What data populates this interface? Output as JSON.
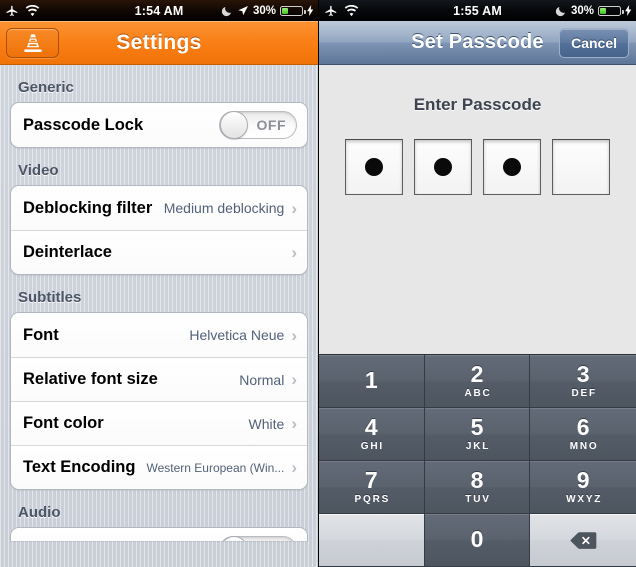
{
  "left_pane": {
    "status_bar": {
      "icons_left": [
        "airplane-icon",
        "wifi-icon"
      ],
      "time": "1:54 AM",
      "icons_right": [
        "moon-icon",
        "location-arrow-icon"
      ],
      "battery_percent": "30%",
      "battery_level": 30,
      "charging": true
    },
    "nav": {
      "app_icon": "vlc-cone-icon",
      "title": "Settings"
    },
    "sections": [
      {
        "header": "Generic",
        "rows": [
          {
            "label": "Passcode Lock",
            "type": "switch",
            "state": "OFF"
          }
        ]
      },
      {
        "header": "Video",
        "rows": [
          {
            "label": "Deblocking filter",
            "value": "Medium deblocking",
            "type": "disclosure"
          },
          {
            "label": "Deinterlace",
            "value": "",
            "type": "disclosure"
          }
        ]
      },
      {
        "header": "Subtitles",
        "rows": [
          {
            "label": "Font",
            "value": "Helvetica Neue",
            "type": "disclosure"
          },
          {
            "label": "Relative font size",
            "value": "Normal",
            "type": "disclosure"
          },
          {
            "label": "Font color",
            "value": "White",
            "type": "disclosure"
          },
          {
            "label": "Text Encoding",
            "value": "Western European (Win...",
            "type": "disclosure"
          }
        ]
      },
      {
        "header": "Audio",
        "rows": [
          {
            "label": "",
            "value": "",
            "type": "clipped"
          }
        ]
      }
    ]
  },
  "right_pane": {
    "status_bar": {
      "icons_left": [
        "airplane-icon",
        "wifi-icon"
      ],
      "time": "1:55 AM",
      "icons_right": [
        "moon-icon"
      ],
      "battery_percent": "30%",
      "battery_level": 30,
      "charging": true
    },
    "nav": {
      "title": "Set Passcode",
      "cancel_label": "Cancel"
    },
    "passcode": {
      "prompt": "Enter Passcode",
      "total_boxes": 4,
      "filled_boxes": 3
    },
    "keypad": [
      {
        "num": "1",
        "letters": ""
      },
      {
        "num": "2",
        "letters": "ABC"
      },
      {
        "num": "3",
        "letters": "DEF"
      },
      {
        "num": "4",
        "letters": "GHI"
      },
      {
        "num": "5",
        "letters": "JKL"
      },
      {
        "num": "6",
        "letters": "MNO"
      },
      {
        "num": "7",
        "letters": "PQRS"
      },
      {
        "num": "8",
        "letters": "TUV"
      },
      {
        "num": "9",
        "letters": "WXYZ"
      },
      {
        "num": "",
        "letters": "",
        "kind": "blank"
      },
      {
        "num": "0",
        "letters": ""
      },
      {
        "num": "",
        "letters": "",
        "kind": "delete",
        "icon": "backspace-icon"
      }
    ]
  },
  "colors": {
    "accent_orange": "#fa7f15",
    "nav_blue": "#7e94b4",
    "key_dark": "#575f6b",
    "battery_green": "#3fc21a"
  }
}
